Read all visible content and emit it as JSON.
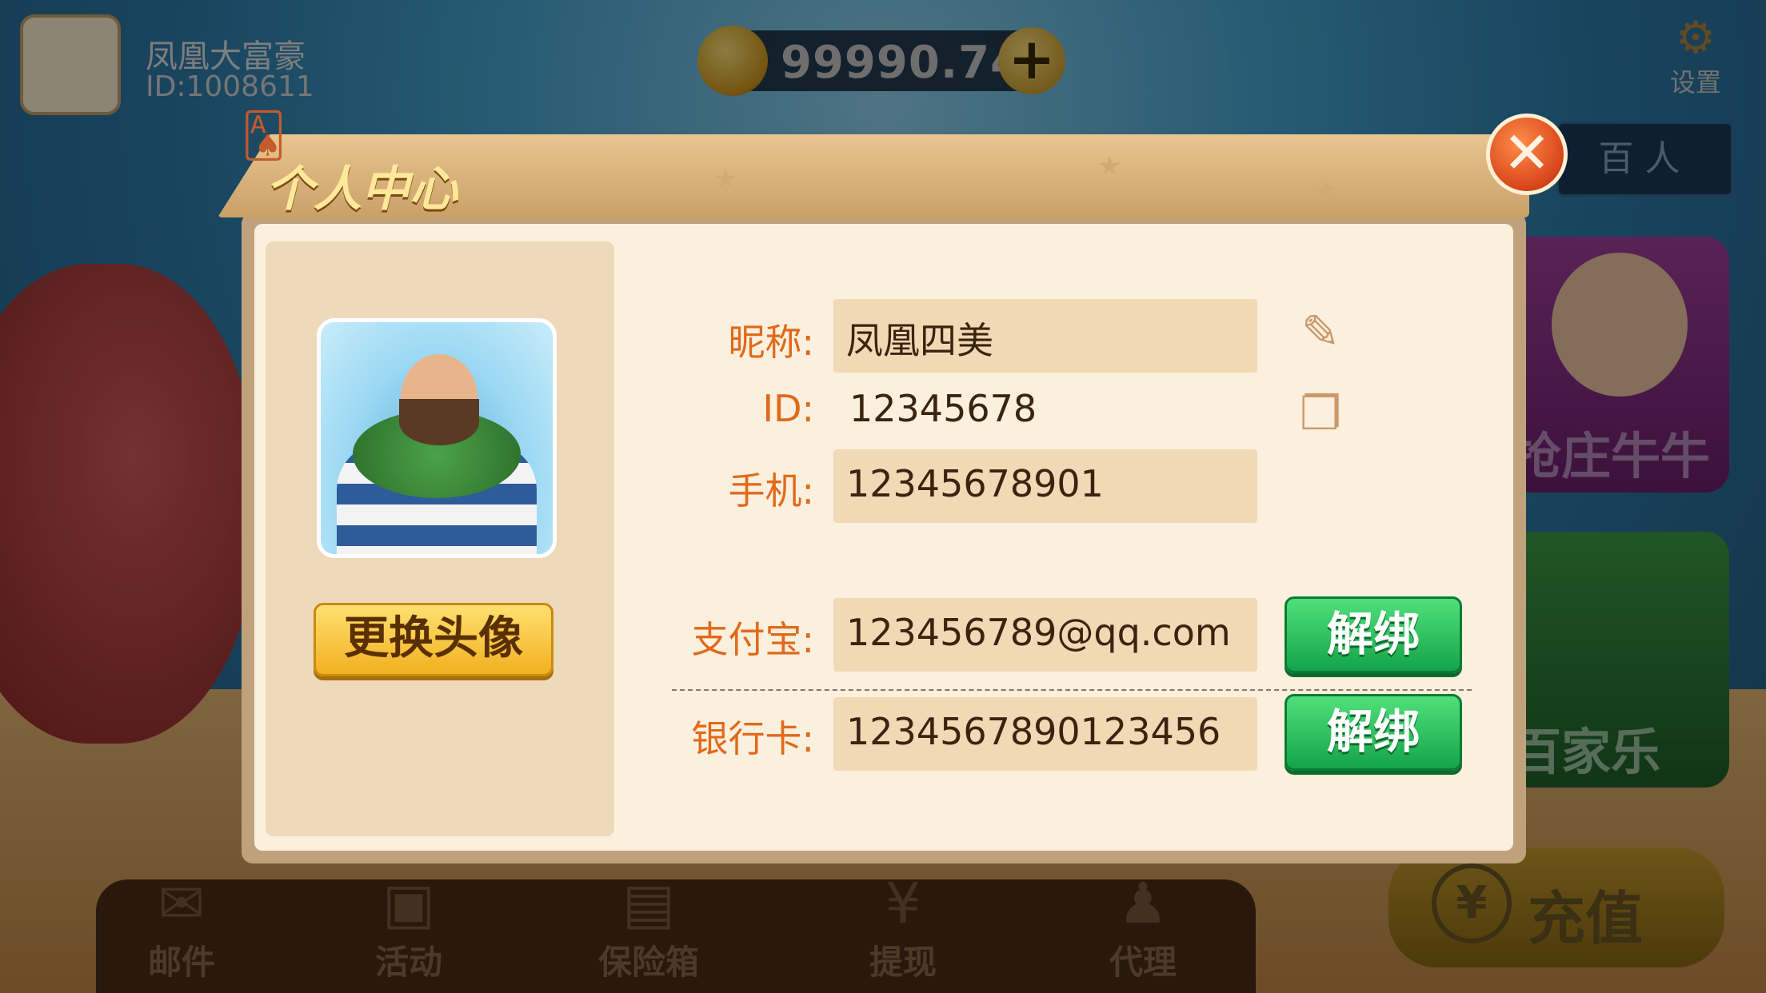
{
  "topbar": {
    "user_name": "凤凰大富豪",
    "user_id": "ID:1008611",
    "coins": "99990.74",
    "add_coins_label": "+",
    "settings_label": "设置"
  },
  "top_tab": {
    "label": "百人"
  },
  "game_tiles": [
    {
      "label": "抢庄牛牛"
    },
    {
      "label": "百家乐"
    }
  ],
  "recharge": {
    "label": "充值",
    "icon": "¥"
  },
  "bottom_nav": [
    {
      "label": "邮件",
      "icon": "mail-icon"
    },
    {
      "label": "活动",
      "icon": "gift-icon"
    },
    {
      "label": "保险箱",
      "icon": "safe-icon"
    },
    {
      "label": "提现",
      "icon": "withdraw-icon"
    },
    {
      "label": "代理",
      "icon": "agent-icon"
    }
  ],
  "dialog": {
    "title": "个人中心",
    "close_label": "✕",
    "change_avatar_label": "更换头像",
    "fields": {
      "nickname": {
        "label": "昵称:",
        "value": "凤凰四美"
      },
      "id": {
        "label": "ID:",
        "value": "12345678"
      },
      "phone": {
        "label": "手机:",
        "value": "12345678901"
      },
      "alipay": {
        "label": "支付宝:",
        "value": "123456789@qq.com",
        "action": "解绑"
      },
      "bank_card": {
        "label": "银行卡:",
        "value": "1234567890123456",
        "action": "解绑"
      }
    }
  },
  "colors": {
    "label_orange": "#e06a1a",
    "unbind_green": "#14a44a",
    "close_orange": "#d8451b",
    "panel_cream": "#fbefdd"
  }
}
